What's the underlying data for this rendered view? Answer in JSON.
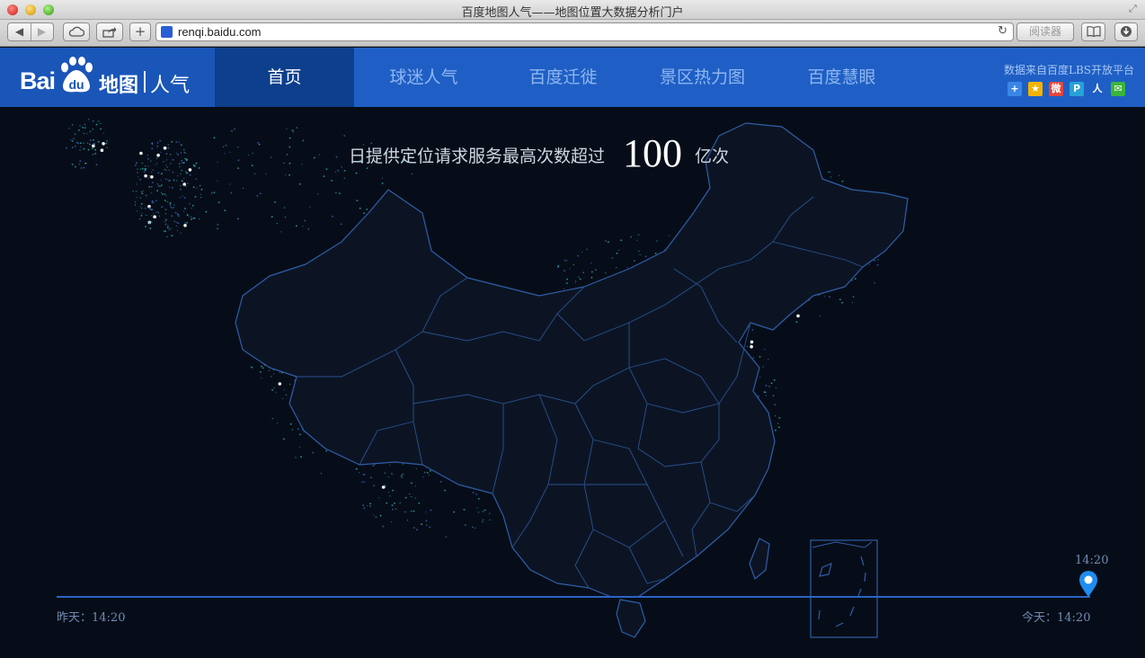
{
  "browser": {
    "window_title": "百度地图人气——地图位置大数据分析门户",
    "url": "renqi.baidu.com",
    "reader_label": "阅读器"
  },
  "header": {
    "logo_bai": "Bai",
    "logo_du": "du",
    "logo_map": "地图",
    "logo_renqi": "人气",
    "nav": [
      {
        "label": "首页",
        "active": true
      },
      {
        "label": "球迷人气",
        "active": false
      },
      {
        "label": "百度迁徙",
        "active": false
      },
      {
        "label": "景区热力图",
        "active": false
      },
      {
        "label": "百度慧眼",
        "active": false
      }
    ],
    "lbs_note": "数据来自百度LBS开放平台",
    "share_icons": [
      "plus-share",
      "qzone",
      "weibo",
      "tencent-weibo",
      "renren",
      "wechat"
    ]
  },
  "main": {
    "headline_lead": "日提供定位请求服务最高次数超过",
    "headline_number": "100",
    "headline_unit": "亿次"
  },
  "timeline": {
    "start_label": "昨天：14:20",
    "end_label": "今天：14:20",
    "current_time": "14:20",
    "progress": 1.0
  },
  "colors": {
    "header_bg": "#1f5fc5",
    "active_tab_bg": "#0e3f8c",
    "map_bg": "#070d18",
    "border_line": "#2f5ea8",
    "dot_cyan": "#2fd2c8",
    "dot_white": "#ffffff",
    "timeline": "#2a64c4",
    "pin": "#1e8cf0"
  }
}
